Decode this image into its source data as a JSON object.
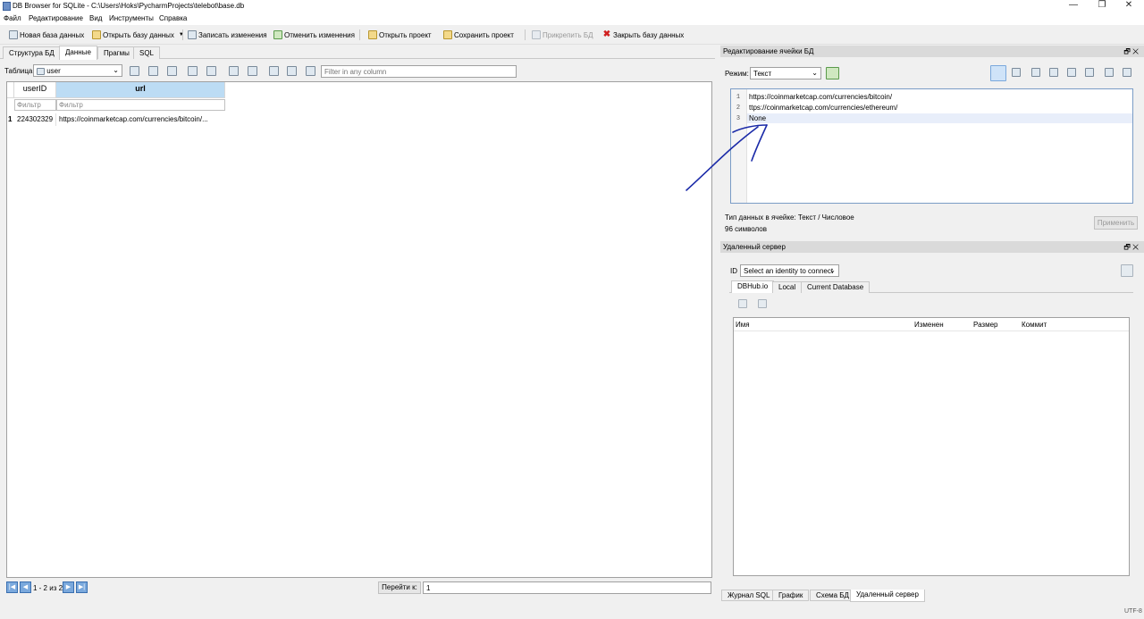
{
  "window": {
    "title": "DB Browser for SQLite - C:\\Users\\Hoks\\PycharmProjects\\telebot\\base.db",
    "minimize": "—",
    "maximize": "❐",
    "close": "✕"
  },
  "menu": [
    "Файл",
    "Редактирование",
    "Вид",
    "Инструменты",
    "Справка"
  ],
  "toolbar": {
    "new_db": "Новая база данных",
    "open_db": "Открыть базу данных",
    "write_changes": "Записать изменения",
    "revert_changes": "Отменить изменения",
    "open_project": "Открыть проект",
    "save_project": "Сохранить проект",
    "attach_db": "Прикрепить БД",
    "close_db": "Закрыть базу данных"
  },
  "main_tabs": [
    "Структура БД",
    "Данные",
    "Прагмы",
    "SQL"
  ],
  "data_view": {
    "table_label": "Таблица:",
    "table_selected": "user",
    "filter_placeholder": "Filter in any column",
    "columns": [
      "userID",
      "url"
    ],
    "filter_hint": "Фильтр",
    "rows": [
      {
        "num": "1",
        "userID": "224302329",
        "url": "https://coinmarketcap.com/currencies/bitcoin/..."
      }
    ]
  },
  "pager": {
    "range": "1 - 2 из 2",
    "goto_label": "Перейти к:",
    "goto_value": "1"
  },
  "cell_editor": {
    "title": "Редактирование ячейки БД",
    "mode_label": "Режим:",
    "mode_value": "Текст",
    "lines": [
      {
        "n": "1",
        "text": "https://coinmarketcap.com/currencies/bitcoin/"
      },
      {
        "n": "2",
        "text": "ttps://coinmarketcap.com/currencies/ethereum/"
      },
      {
        "n": "3",
        "text": "None"
      }
    ],
    "type_info": "Тип данных в ячейке: Текст / Числовое",
    "char_count": "96 символов",
    "apply": "Применить"
  },
  "remote": {
    "title": "Удаленный сервер",
    "id_label": "ID",
    "identity_placeholder": "Select an identity to connect",
    "tabs": [
      "DBHub.io",
      "Local",
      "Current Database"
    ],
    "columns": [
      "Имя",
      "Изменен",
      "Размер",
      "Коммит"
    ]
  },
  "bottom_tabs": [
    "Журнал SQL",
    "График",
    "Схема БД",
    "Удаленный сервер"
  ],
  "status": {
    "encoding": "UTF-8"
  },
  "colors": {
    "selected_header": "#bcdcf4",
    "annotation_ink": "#1a2aa8"
  }
}
